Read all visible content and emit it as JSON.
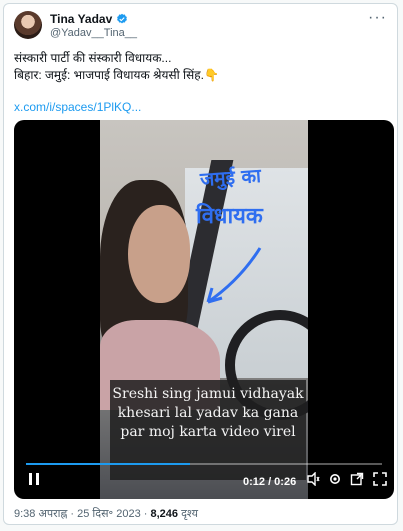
{
  "tweet": {
    "author_name": "Tina Yadav",
    "author_handle": "@Yadav__Tina__",
    "verified": true,
    "more_icon": "more-icon",
    "text_lines": [
      "संस्कारी पार्टी की संस्कारी विधायक...",
      "बिहार: जमुई: भाजपाई विधायक श्रेयसी सिंह.👇"
    ],
    "link_text": "x.com/i/spaces/1PlKQ...",
    "link_color": "#1d9bf0"
  },
  "video": {
    "overlay_text_1": "जमुई का",
    "overlay_text_2": "विधायक",
    "caption": "Sreshi sing jamui vidhayak khesari lal yadav ka gana par moj karta video virel",
    "time_display": "0:12 / 0:26",
    "progress_fraction": 0.46,
    "controls": {
      "play_icon": "pause-icon",
      "captions_icon": "captions-icon",
      "settings_icon": "gear-icon",
      "popout_icon": "popout-icon",
      "fullscreen_icon": "fullscreen-icon"
    }
  },
  "footer": {
    "timestamp": "9:38 अपराह्न · 25 दिस॰ 2023 · ",
    "views_count": "8,246",
    "views_label": " दृश्य"
  }
}
